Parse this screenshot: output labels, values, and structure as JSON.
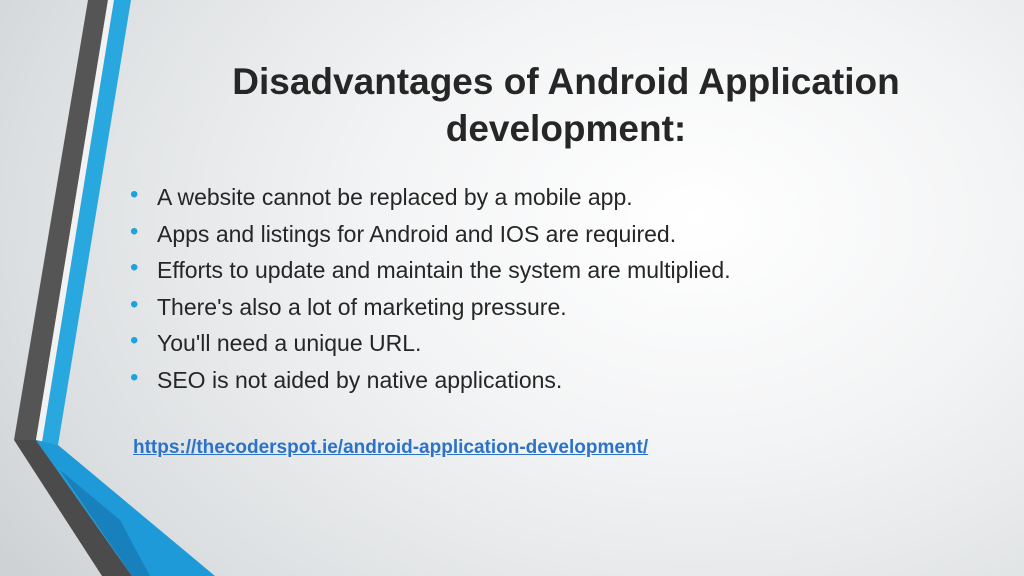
{
  "slide": {
    "title": "Disadvantages of Android Application development:",
    "bullets": [
      "A website cannot be replaced by a mobile app.",
      "Apps and listings for Android and IOS are required.",
      "Efforts to update and maintain the system are multiplied.",
      "There's also a lot of marketing pressure.",
      "You'll need a unique URL.",
      "SEO is not aided by native applications."
    ],
    "link": "https://thecoderspot.ie/android-application-development/"
  },
  "colors": {
    "accent_blue": "#1ca3dd",
    "dark_gray": "#4a4a4a",
    "link": "#2a73c9",
    "text": "#262626"
  }
}
